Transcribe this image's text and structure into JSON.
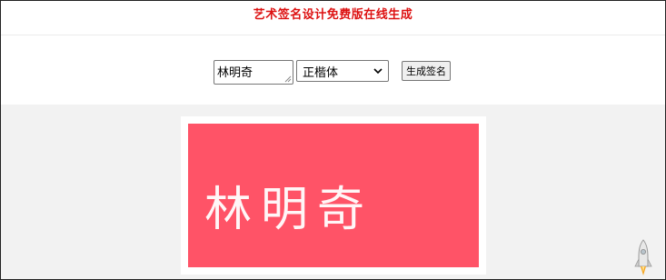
{
  "header": {
    "title": "艺术签名设计免费版在线生成"
  },
  "form": {
    "name_value": "林明奇",
    "font_select": {
      "selected": "正楷体"
    },
    "generate_label": "生成签名"
  },
  "preview": {
    "signature_text": "林明奇",
    "background_color": "#ff5367",
    "text_color": "#ffffff"
  },
  "widgets": {
    "back_to_top_icon": "rocket-icon"
  }
}
